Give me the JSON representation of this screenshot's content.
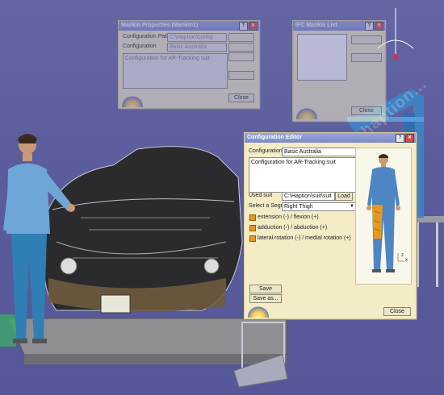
{
  "colors": {
    "background": "#5e60a0",
    "dialog": "#f4ecc6",
    "titlebar": "#8c97d2",
    "accent": "#e59a1d",
    "mannequin_body": "#4d86c3"
  },
  "watermark": "www.haption...",
  "mankin_properties": {
    "title": "Mankin Properties (Mankin1)",
    "config_path_label": "Configuration Path",
    "config_path_value": "C:\\Haption\\config",
    "configuration_label": "Configuration",
    "configuration_value": "Basic Australia",
    "description": "Configuration for AR-Tracking suit",
    "close_label": "Close"
  },
  "ifc_list": {
    "title": "IFC Mankin List",
    "close_label": "Close"
  },
  "config_editor": {
    "title": "Configuration Editor",
    "configuration_label": "Configuration",
    "configuration_value": "Basic Australia",
    "description": "Configuration for AR-Tracking suit",
    "used_suit_label": "Used suit",
    "used_suit_value": "C:\\Haption\\suit\\suit",
    "load_label": "Load",
    "segment_label": "Select a Segment",
    "segment_value": "Right Thigh",
    "options": [
      "extension (-) / flexion (+)",
      "adduction (-) / abduction (+)",
      "lateral rotation (-) / medial rotation (+)"
    ],
    "save_label": "Save",
    "save_as_label": "Save as...",
    "close_label": "Close",
    "axis_x": "x",
    "axis_z": "z"
  }
}
